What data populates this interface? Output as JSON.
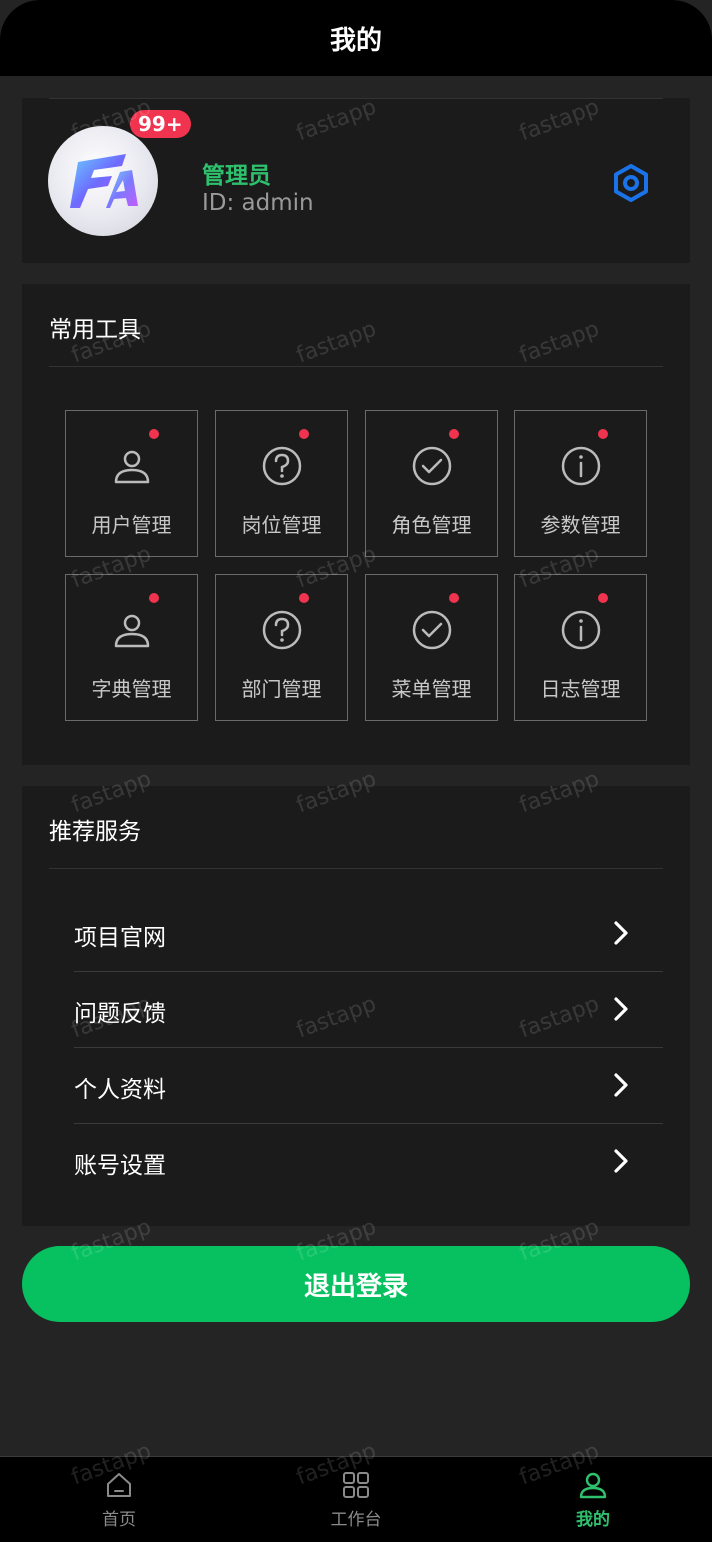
{
  "header": {
    "title": "我的"
  },
  "profile": {
    "badge": "99+",
    "name": "管理员",
    "id_text": "ID: admin",
    "settings_icon": "settings-hex-icon"
  },
  "tools": {
    "title": "常用工具",
    "items": [
      {
        "label": "用户管理",
        "icon": "user-icon"
      },
      {
        "label": "岗位管理",
        "icon": "question-icon"
      },
      {
        "label": "角色管理",
        "icon": "check-circle-icon"
      },
      {
        "label": "参数管理",
        "icon": "info-icon"
      },
      {
        "label": "字典管理",
        "icon": "user-icon"
      },
      {
        "label": "部门管理",
        "icon": "question-icon"
      },
      {
        "label": "菜单管理",
        "icon": "check-circle-icon"
      },
      {
        "label": "日志管理",
        "icon": "info-icon"
      }
    ]
  },
  "services": {
    "title": "推荐服务",
    "items": [
      {
        "label": "项目官网"
      },
      {
        "label": "问题反馈"
      },
      {
        "label": "个人资料"
      },
      {
        "label": "账号设置"
      }
    ]
  },
  "logout": {
    "label": "退出登录"
  },
  "tabbar": {
    "items": [
      {
        "label": "首页",
        "icon": "home-icon"
      },
      {
        "label": "工作台",
        "icon": "grid-icon"
      },
      {
        "label": "我的",
        "icon": "user-icon"
      }
    ],
    "active_index": 2
  },
  "watermark": "fastapp",
  "colors": {
    "accent": "#07c160",
    "name": "#2fc06e",
    "badge": "#f0344f",
    "settings": "#1a73e8"
  }
}
